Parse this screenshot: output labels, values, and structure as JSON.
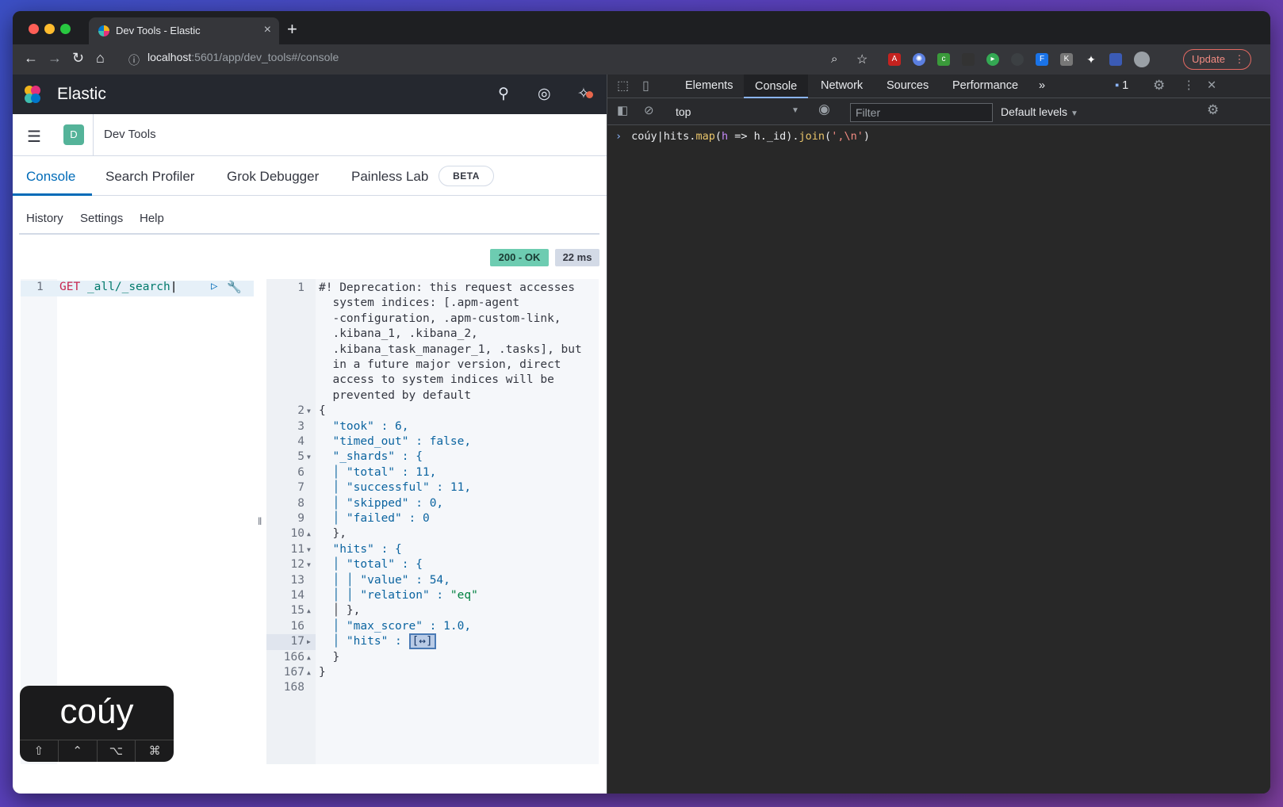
{
  "browser": {
    "tab_title": "Dev Tools - Elastic",
    "url_host": "localhost",
    "url_rest": ":5601/app/dev_tools#/console",
    "update_label": "Update"
  },
  "kibana": {
    "brand": "Elastic",
    "app_badge": "D",
    "breadcrumb": "Dev Tools",
    "tabs": [
      "Console",
      "Search Profiler",
      "Grok Debugger",
      "Painless Lab"
    ],
    "beta_label": "BETA",
    "menu": [
      "History",
      "Settings",
      "Help"
    ],
    "status_code": "200 - OK",
    "status_time": "22 ms",
    "request": {
      "line_no": "1",
      "verb": "GET",
      "path": "_all/_search"
    },
    "response_lines": [
      {
        "n": "1",
        "f": "",
        "t": "#! Deprecation: this request accesses",
        "c": "w"
      },
      {
        "n": "",
        "f": "",
        "t": "  system indices: [.apm-agent",
        "c": "w"
      },
      {
        "n": "",
        "f": "",
        "t": "  -configuration, .apm-custom-link,",
        "c": "w"
      },
      {
        "n": "",
        "f": "",
        "t": "  .kibana_1, .kibana_2,",
        "c": "w"
      },
      {
        "n": "",
        "f": "",
        "t": "  .kibana_task_manager_1, .tasks], but",
        "c": "w"
      },
      {
        "n": "",
        "f": "",
        "t": "  in a future major version, direct",
        "c": "w"
      },
      {
        "n": "",
        "f": "",
        "t": "  access to system indices will be",
        "c": "w"
      },
      {
        "n": "",
        "f": "",
        "t": "  prevented by default",
        "c": "w"
      },
      {
        "n": "2",
        "f": "▼",
        "t": "{",
        "c": ""
      },
      {
        "n": "3",
        "f": "",
        "t": "  \"took\" : 6,",
        "c": "k"
      },
      {
        "n": "4",
        "f": "",
        "t": "  \"timed_out\" : false,",
        "c": "k"
      },
      {
        "n": "5",
        "f": "▼",
        "t": "  \"_shards\" : {",
        "c": "k"
      },
      {
        "n": "6",
        "f": "",
        "t": "  │ \"total\" : 11,",
        "c": "k"
      },
      {
        "n": "7",
        "f": "",
        "t": "  │ \"successful\" : 11,",
        "c": "k"
      },
      {
        "n": "8",
        "f": "",
        "t": "  │ \"skipped\" : 0,",
        "c": "k"
      },
      {
        "n": "9",
        "f": "",
        "t": "  │ \"failed\" : 0",
        "c": "k"
      },
      {
        "n": "10",
        "f": "▲",
        "t": "  },",
        "c": ""
      },
      {
        "n": "11",
        "f": "▼",
        "t": "  \"hits\" : {",
        "c": "k"
      },
      {
        "n": "12",
        "f": "▼",
        "t": "  │ \"total\" : {",
        "c": "k"
      },
      {
        "n": "13",
        "f": "",
        "t": "  │ │ \"value\" : 54,",
        "c": "k"
      },
      {
        "n": "14",
        "f": "",
        "t": "  │ │ \"relation\" : \"eq\"",
        "c": "k"
      },
      {
        "n": "15",
        "f": "▲",
        "t": "  │ },",
        "c": ""
      },
      {
        "n": "16",
        "f": "",
        "t": "  │ \"max_score\" : 1.0,",
        "c": "k"
      },
      {
        "n": "17",
        "f": "▶",
        "t": "  │ \"hits\" : ",
        "c": "k",
        "collapsed": "[↔]"
      },
      {
        "n": "166",
        "f": "▲",
        "t": "  }",
        "c": ""
      },
      {
        "n": "167",
        "f": "▲",
        "t": "}",
        "c": ""
      },
      {
        "n": "168",
        "f": "",
        "t": "",
        "c": ""
      }
    ]
  },
  "keystroke_overlay": {
    "text": "coúy",
    "keys": [
      "⇧",
      "⌃",
      "⌥",
      "⌘"
    ]
  },
  "devtools": {
    "tabs": [
      "Elements",
      "Console",
      "Network",
      "Sources",
      "Performance"
    ],
    "active_tab": "Console",
    "issues_count": "1",
    "context": "top",
    "filter_placeholder": "Filter",
    "levels": "Default levels",
    "command_parts": {
      "a": "coúy",
      "b": "hits.",
      "c": "map",
      "d": "(",
      "e": "h",
      "f": " => ",
      "g": "h._id).",
      "h": "join",
      "i": "(",
      "j": "',\\n'",
      "k": ")"
    }
  }
}
